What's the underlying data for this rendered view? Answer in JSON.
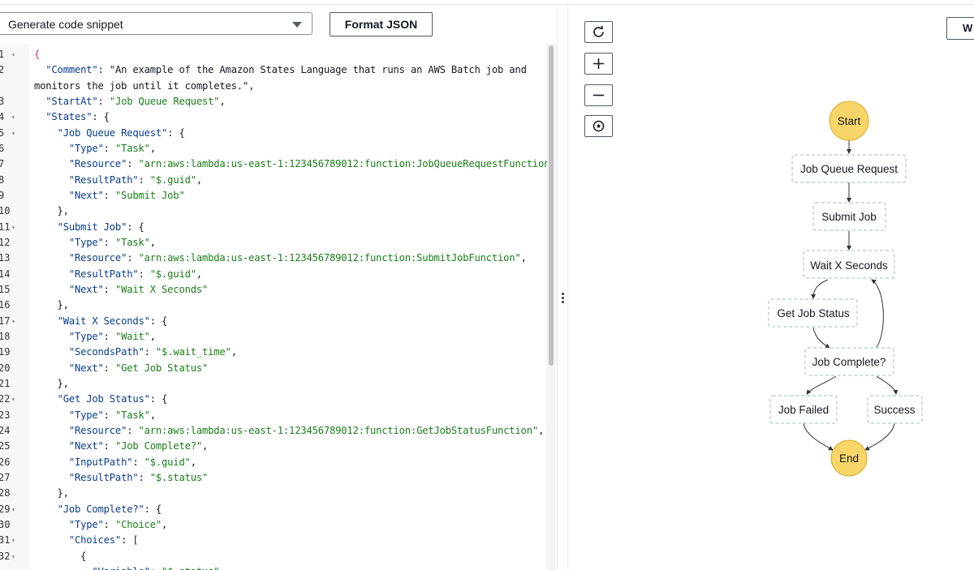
{
  "toolbar": {
    "snippet_select": "Generate code snippet",
    "format_button": "Format JSON"
  },
  "editor": {
    "line_numbers": [
      "1",
      "2",
      "3",
      "4",
      "5",
      "6",
      "7",
      "8",
      "9",
      "10",
      "11",
      "12",
      "13",
      "14",
      "15",
      "16",
      "17",
      "18",
      "19",
      "20",
      "21",
      "22",
      "23",
      "24",
      "25",
      "26",
      "27",
      "28",
      "29",
      "30",
      "31",
      "32"
    ],
    "fold_lines": [
      "1",
      "4",
      "5",
      "11",
      "17",
      "22",
      "29",
      "31",
      "32"
    ],
    "lines": [
      "{",
      "  \"Comment\": \"An example of the Amazon States Language that runs an AWS Batch job and",
      "monitors the job until it completes.\",",
      "  \"StartAt\": \"Job Queue Request\",",
      "  \"States\": {",
      "    \"Job Queue Request\": {",
      "      \"Type\": \"Task\",",
      "      \"Resource\": \"arn:aws:lambda:us-east-1:123456789012:function:JobQueueRequestFunction\",",
      "      \"ResultPath\": \"$.guid\",",
      "      \"Next\": \"Submit Job\"",
      "    },",
      "    \"Submit Job\": {",
      "      \"Type\": \"Task\",",
      "      \"Resource\": \"arn:aws:lambda:us-east-1:123456789012:function:SubmitJobFunction\",",
      "      \"ResultPath\": \"$.guid\",",
      "      \"Next\": \"Wait X Seconds\"",
      "    },",
      "    \"Wait X Seconds\": {",
      "      \"Type\": \"Wait\",",
      "      \"SecondsPath\": \"$.wait_time\",",
      "      \"Next\": \"Get Job Status\"",
      "    },",
      "    \"Get Job Status\": {",
      "      \"Type\": \"Task\",",
      "      \"Resource\": \"arn:aws:lambda:us-east-1:123456789012:function:GetJobStatusFunction\",",
      "      \"Next\": \"Job Complete?\",",
      "      \"InputPath\": \"$.guid\",",
      "      \"ResultPath\": \"$.status\"",
      "    },",
      "    \"Job Complete?\": {",
      "      \"Type\": \"Choice\",",
      "      \"Choices\": [",
      "        {",
      "          \"Variable\": \"$.status\","
    ]
  },
  "graph": {
    "controls": [
      "refresh-icon",
      "zoom-in-icon",
      "zoom-out-icon",
      "center-icon"
    ],
    "right_button": "W",
    "nodes": {
      "start": "Start",
      "job_queue_request": "Job Queue Request",
      "submit_job": "Submit Job",
      "wait": "Wait X Seconds",
      "get_status": "Get Job Status",
      "job_complete": "Job Complete?",
      "job_failed": "Job Failed",
      "success": "Success",
      "end": "End"
    },
    "colors": {
      "terminal_fill": "#f8d568",
      "terminal_stroke": "#d9a92a",
      "node_border": "#aab7b8"
    }
  }
}
